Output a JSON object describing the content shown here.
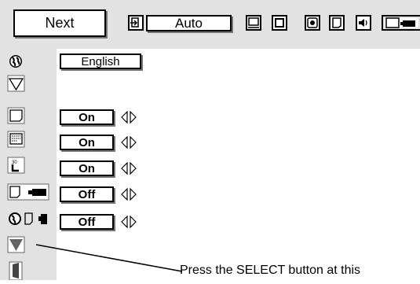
{
  "toolbar": {
    "menu_label": "Next",
    "mode_label": "Auto",
    "icons": [
      "input-icon",
      "pc-adjust-icon",
      "image-select-icon",
      "image-adjust-icon",
      "screen-icon",
      "sound-icon",
      "setting-icon"
    ]
  },
  "sidebar": {
    "items": [
      {
        "icon": "language-icon",
        "value": "English"
      },
      {
        "icon": "keystone-icon",
        "value": ""
      },
      {
        "icon": "blue-back-icon",
        "value": "On",
        "arrows": true
      },
      {
        "icon": "display-icon",
        "value": "On",
        "arrows": true
      },
      {
        "icon": "logo-icon",
        "value": "On",
        "arrows": true
      },
      {
        "icon": "ceiling-icon",
        "value": "Off",
        "arrows": true
      },
      {
        "icon": "rear-icon",
        "value": "Off",
        "arrows": true
      },
      {
        "icon": "next-page-icon",
        "value": ""
      },
      {
        "icon": "exit-icon",
        "value": ""
      }
    ]
  },
  "callout": {
    "text": "Press the SELECT button at this"
  }
}
